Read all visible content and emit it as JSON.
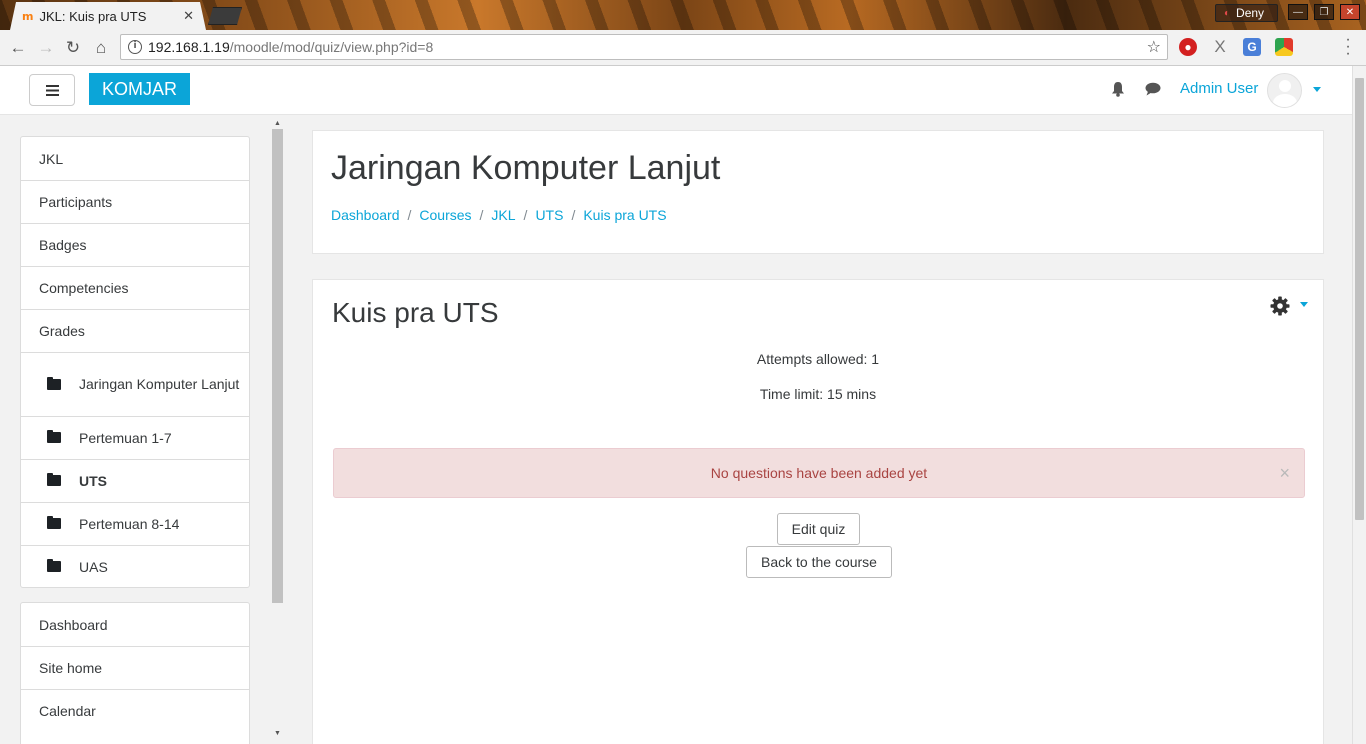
{
  "browser": {
    "tab_title": "JKL: Kuis pra UTS",
    "tab_favicon": "m",
    "deny_label": "Deny",
    "url_host": "192.168.1.19",
    "url_path": "/moodle/mod/quiz/view.php?id=8",
    "icons": [
      "back-icon",
      "forward-icon",
      "reload-icon",
      "home-icon",
      "info-icon",
      "star-icon",
      "shield-extension-icon",
      "x-extension-icon",
      "translate-extension-icon",
      "drive-extension-icon",
      "menu-icon"
    ]
  },
  "navbar": {
    "brand": "KOMJAR",
    "user_name": "Admin User",
    "accent_color": "#0ba5d8"
  },
  "drawer": {
    "course_items": [
      {
        "label": "JKL"
      },
      {
        "label": "Participants"
      },
      {
        "label": "Badges"
      },
      {
        "label": "Competencies"
      },
      {
        "label": "Grades"
      }
    ],
    "sections": [
      {
        "label": "Jaringan Komputer Lanjut"
      },
      {
        "label": "Pertemuan 1-7"
      },
      {
        "label": "UTS",
        "active": true
      },
      {
        "label": "Pertemuan 8-14"
      },
      {
        "label": "UAS"
      }
    ],
    "site_items": [
      {
        "label": "Dashboard"
      },
      {
        "label": "Site home"
      },
      {
        "label": "Calendar"
      }
    ]
  },
  "header": {
    "course_title": "Jaringan Komputer Lanjut",
    "breadcrumb": [
      "Dashboard",
      "Courses",
      "JKL",
      "UTS",
      "Kuis pra UTS"
    ],
    "separator": "/"
  },
  "quiz": {
    "title": "Kuis pra UTS",
    "attempts_allowed": "Attempts allowed: 1",
    "time_limit": "Time limit: 15 mins",
    "alert_text": "No questions have been added yet",
    "alert_close": "×",
    "edit_button": "Edit quiz",
    "back_button": "Back to the course"
  }
}
